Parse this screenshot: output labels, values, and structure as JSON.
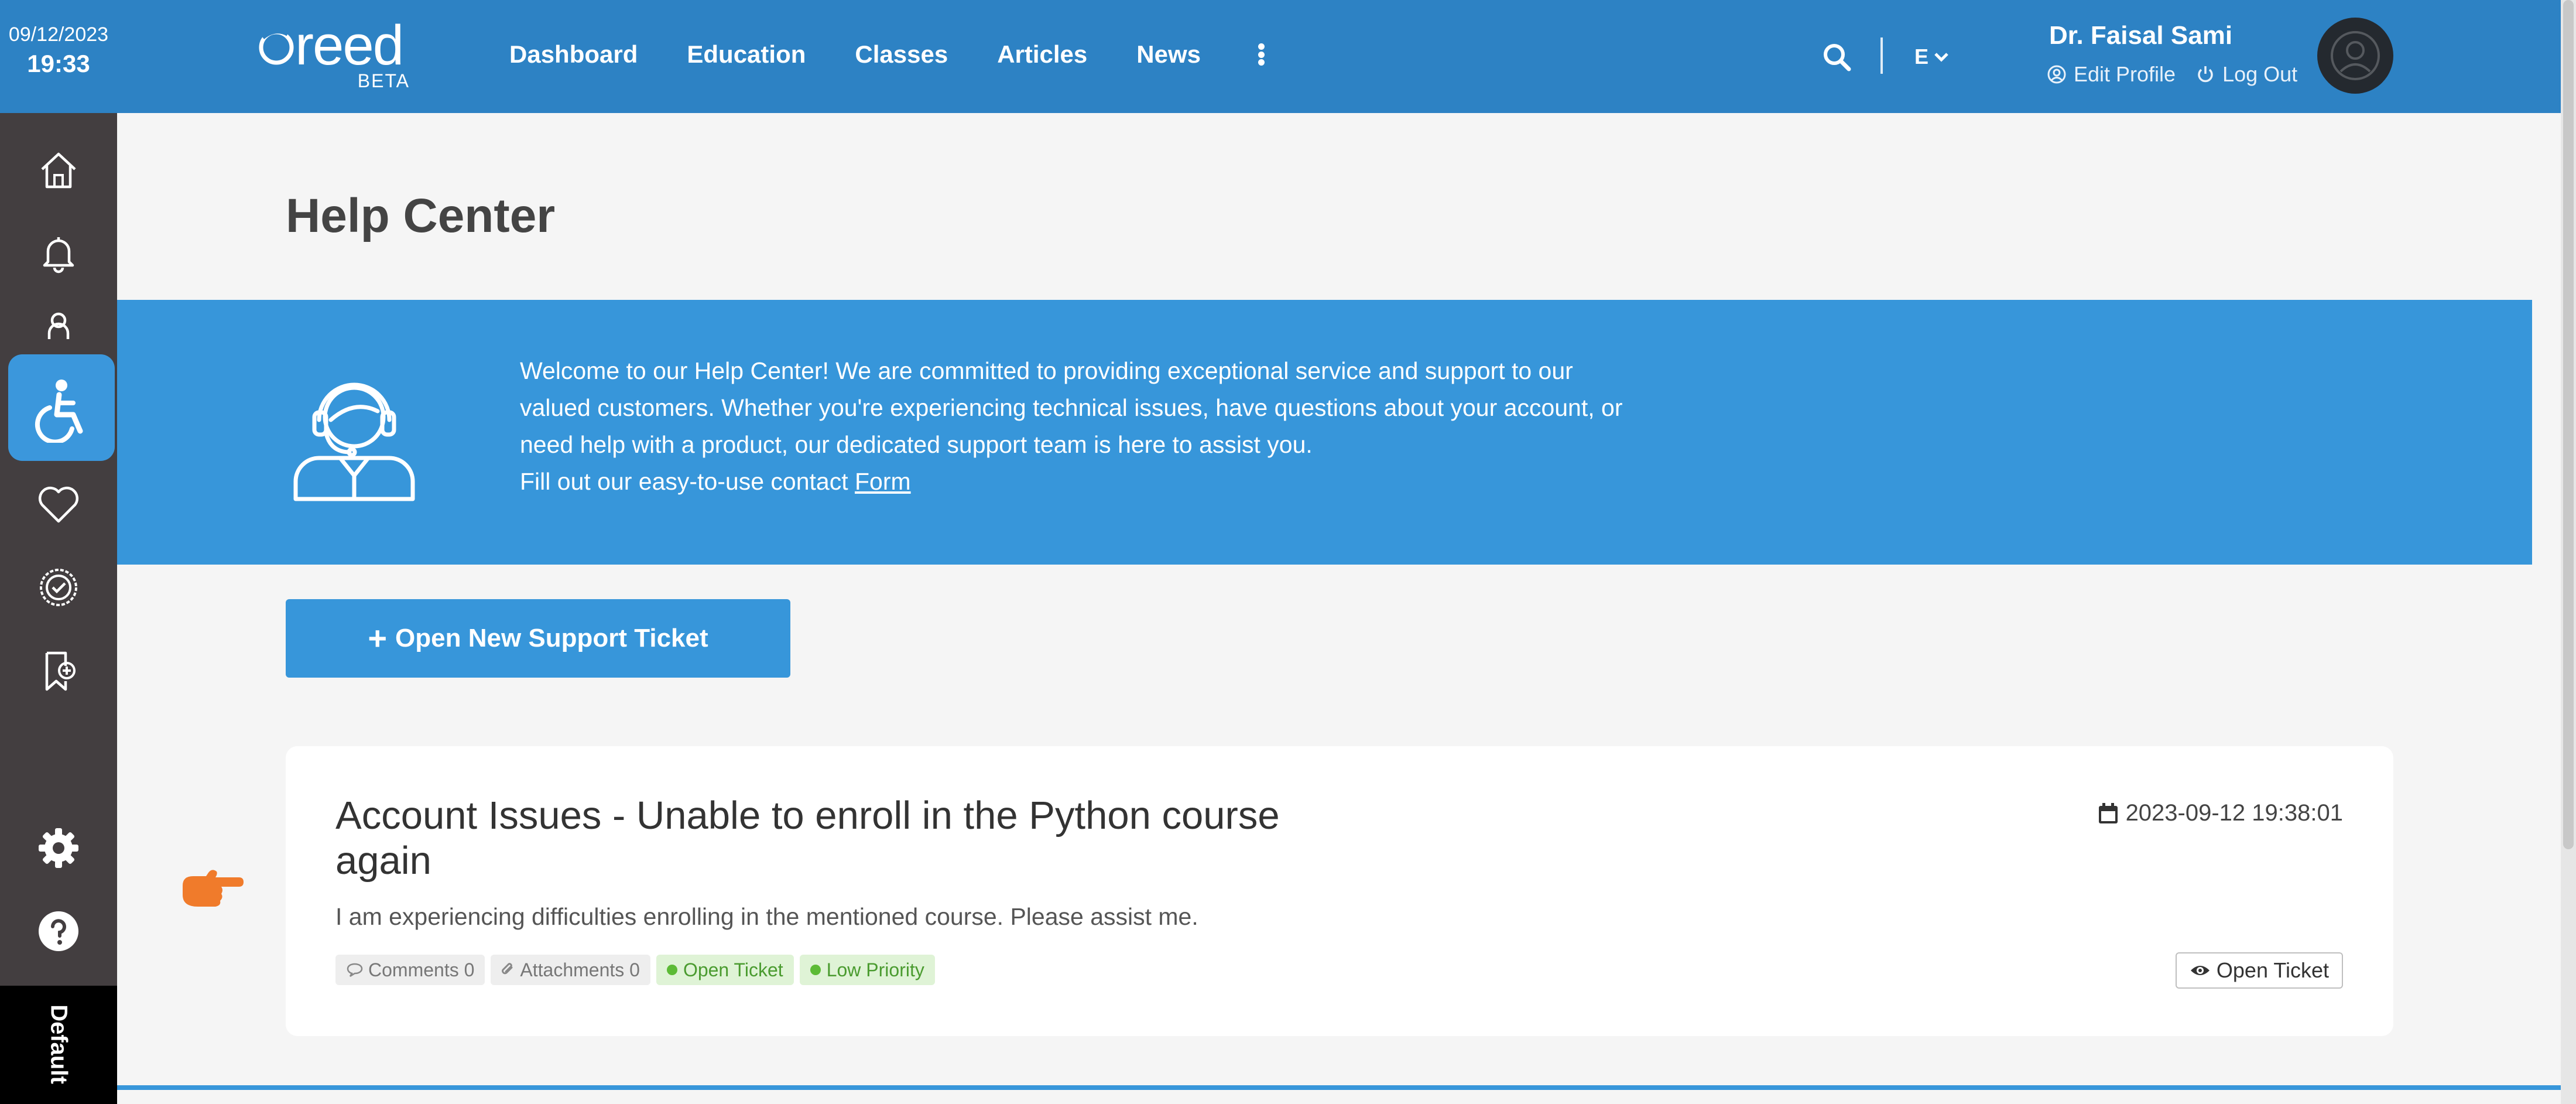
{
  "header": {
    "date": "09/12/2023",
    "time": "19:33",
    "logo_text": "reed",
    "logo_badge": "BETA",
    "nav": [
      "Dashboard",
      "Education",
      "Classes",
      "Articles",
      "News"
    ],
    "language": "E",
    "user_name": "Dr. Faisal Sami",
    "edit_profile": "Edit Profile",
    "logout": "Log Out"
  },
  "sidebar": {
    "items": [
      "home-icon",
      "bell-icon",
      "person-icon",
      "accessibility-icon",
      "heart-icon",
      "badge-check-icon",
      "bookmark-add-icon",
      "settings-icon",
      "help-icon"
    ],
    "active": "accessibility-icon",
    "default_label": "Default"
  },
  "page": {
    "title": "Help Center",
    "banner_text": "Welcome to our Help Center! We are committed to providing exceptional service and support to our valued customers. Whether you're experiencing technical issues, have questions about your account, or need help with a product, our dedicated support team is here to assist you.",
    "banner_cta_prefix": "Fill out our easy-to-use contact",
    "banner_cta_link": "Form",
    "new_ticket_button": "Open New Support Ticket"
  },
  "tickets": [
    {
      "title": "Account Issues - Unable to enroll in the Python course again",
      "datetime": "2023-09-12 19:38:01",
      "description": "I am experiencing difficulties enrolling in the mentioned course. Please assist me.",
      "comments_label": "Comments 0",
      "attachments_label": "Attachments 0",
      "status": "Open Ticket",
      "priority": "Low Priority",
      "action": "Open Ticket"
    }
  ],
  "colors": {
    "header": "#2d82c4",
    "sidebar": "#433e40",
    "accent": "#3796da",
    "pointer": "#f07b2b",
    "status_green": "#5cbb35"
  }
}
